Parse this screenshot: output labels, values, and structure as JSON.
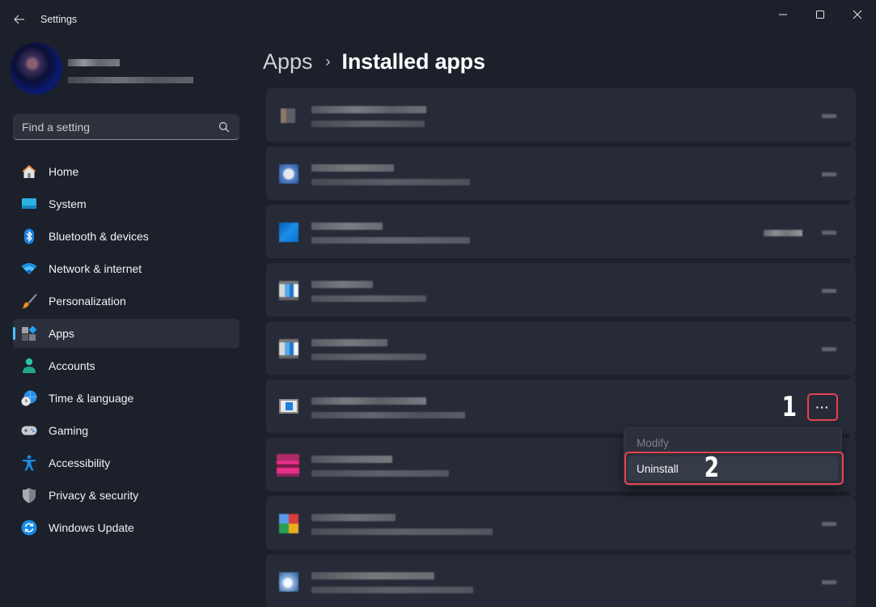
{
  "window": {
    "title": "Settings",
    "controls": {
      "minimize": "minimize",
      "maximize": "maximize",
      "close": "close"
    }
  },
  "profile": {
    "name": "[blurred]",
    "email": "[blurred]"
  },
  "search": {
    "placeholder": "Find a setting",
    "value": ""
  },
  "sidebar": {
    "items": [
      {
        "label": "Home",
        "icon": "home-icon",
        "active": false
      },
      {
        "label": "System",
        "icon": "system-icon",
        "active": false
      },
      {
        "label": "Bluetooth & devices",
        "icon": "bluetooth-icon",
        "active": false
      },
      {
        "label": "Network & internet",
        "icon": "wifi-icon",
        "active": false
      },
      {
        "label": "Personalization",
        "icon": "brush-icon",
        "active": false
      },
      {
        "label": "Apps",
        "icon": "apps-icon",
        "active": true
      },
      {
        "label": "Accounts",
        "icon": "person-icon",
        "active": false
      },
      {
        "label": "Time & language",
        "icon": "globe-clock-icon",
        "active": false
      },
      {
        "label": "Gaming",
        "icon": "gamepad-icon",
        "active": false
      },
      {
        "label": "Accessibility",
        "icon": "accessibility-icon",
        "active": false
      },
      {
        "label": "Privacy & security",
        "icon": "shield-icon",
        "active": false
      },
      {
        "label": "Windows Update",
        "icon": "update-icon",
        "active": false
      }
    ]
  },
  "header": {
    "breadcrumb_parent": "Apps",
    "separator": "›",
    "title": "Installed apps"
  },
  "apps": {
    "items": [
      {
        "name": "[blurred]",
        "details": "[blurred]",
        "size_visible": false,
        "icon_colors": [
          "#8a7a68",
          "#5c5f66"
        ]
      },
      {
        "name": "[blurred]",
        "details": "[blurred]",
        "size_visible": false,
        "icon_colors": [
          "#2f5ea8",
          "#d6dce8"
        ]
      },
      {
        "name": "[blurred]",
        "details": "[blurred]",
        "size_visible": true,
        "icon_colors": [
          "#0a6fd0",
          "#2aa0ea"
        ]
      },
      {
        "name": "[blurred]",
        "details": "[blurred]",
        "size_visible": false,
        "icon_colors": [
          "#d8d8d8",
          "#2a7fd4"
        ]
      },
      {
        "name": "[blurred]",
        "details": "[blurred]",
        "size_visible": false,
        "icon_colors": [
          "#d8d8d8",
          "#2a7fd4"
        ]
      },
      {
        "name": "[blurred]",
        "details": "[blurred]",
        "size_visible": false,
        "icon_colors": [
          "#d0d0d0",
          "#1a78d0"
        ],
        "menu_open": true
      },
      {
        "name": "[blurred]",
        "details": "[blurred]",
        "size_visible": false,
        "icon_colors": [
          "#b02a6a",
          "#e8308a"
        ]
      },
      {
        "name": "[blurred]",
        "details": "[blurred]",
        "size_visible": false,
        "icon_colors": [
          "#d83b3b",
          "#3aa050"
        ]
      },
      {
        "name": "[blurred]",
        "details": "[blurred]",
        "size_visible": false,
        "icon_colors": [
          "#5b86b8",
          "#f0f4fa"
        ]
      }
    ],
    "more_button_label": "···"
  },
  "context_menu": {
    "items": [
      {
        "label": "Modify",
        "enabled": false
      },
      {
        "label": "Uninstall",
        "enabled": true,
        "highlighted": true
      }
    ]
  },
  "annotations": {
    "step1": "1",
    "step2": "2",
    "accent_color": "#e6424e"
  },
  "colors": {
    "accent": "#4cc2ff",
    "background": "#1b202a",
    "card": "#262b37"
  }
}
